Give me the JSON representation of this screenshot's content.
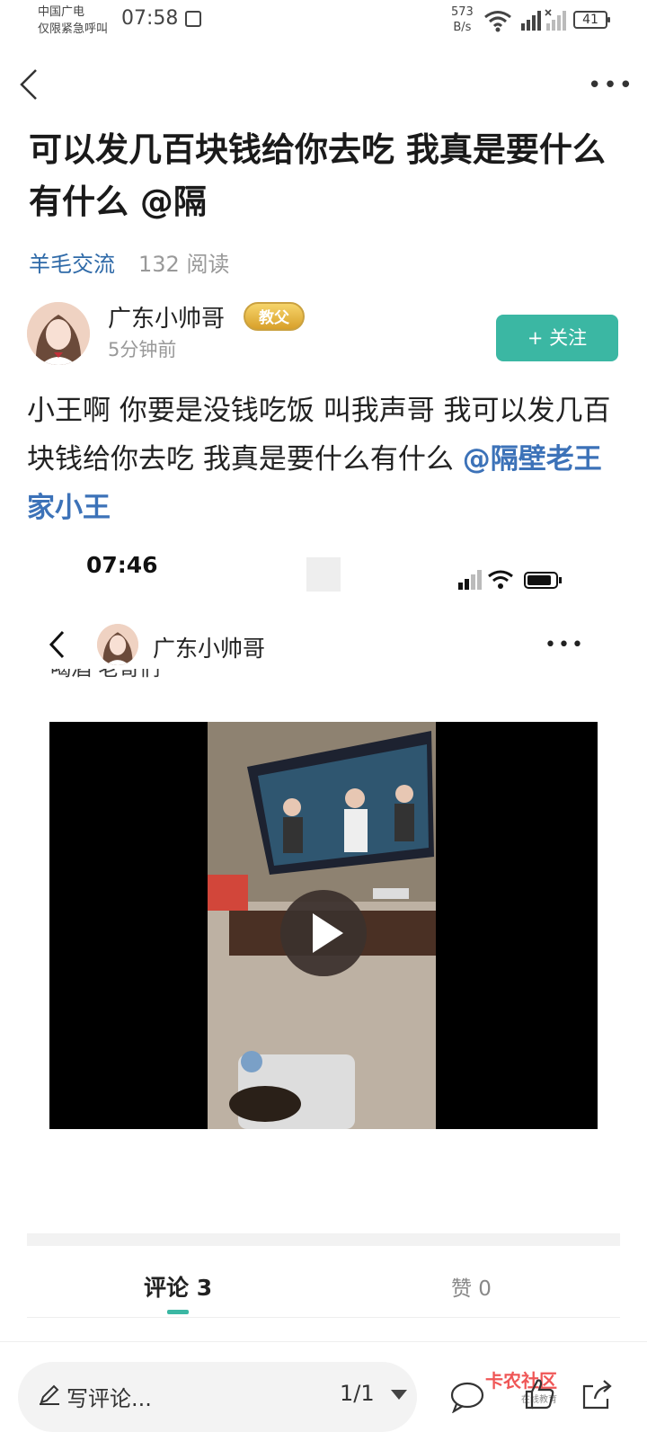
{
  "status_bar": {
    "carrier_line1": "中国广电",
    "carrier_line2": "仅限紧急呼叫",
    "time": "07:58",
    "net_speed_value": "573",
    "net_speed_unit": "B/s",
    "battery": "41"
  },
  "post": {
    "title": "可以发几百块钱给你去吃 我真是要什么有什么 @隔",
    "category": "羊毛交流",
    "reads": "132 阅读",
    "author": "广东小帅哥",
    "badge": "教父",
    "time_ago": "5分钟前",
    "follow_label": "+ 关注",
    "body": "小王啊 你要是没钱吃饭 叫我声哥 我可以发几百块钱给你去吃  我真是要什么有什么 ",
    "mention": "@隔壁老王家小王"
  },
  "embedded": {
    "time": "07:46",
    "author": "广东小帅哥",
    "cut_text": "喝酒 老哥们"
  },
  "tabs": {
    "comments": "评论 3",
    "likes": "赞 0"
  },
  "bottom": {
    "comment_placeholder": "写评论...",
    "pager": "1/1",
    "watermark": "卡农社区",
    "watermark_sub": "在线教育"
  },
  "colors": {
    "accent": "#3bb7a3",
    "link": "#2f6aa8"
  }
}
